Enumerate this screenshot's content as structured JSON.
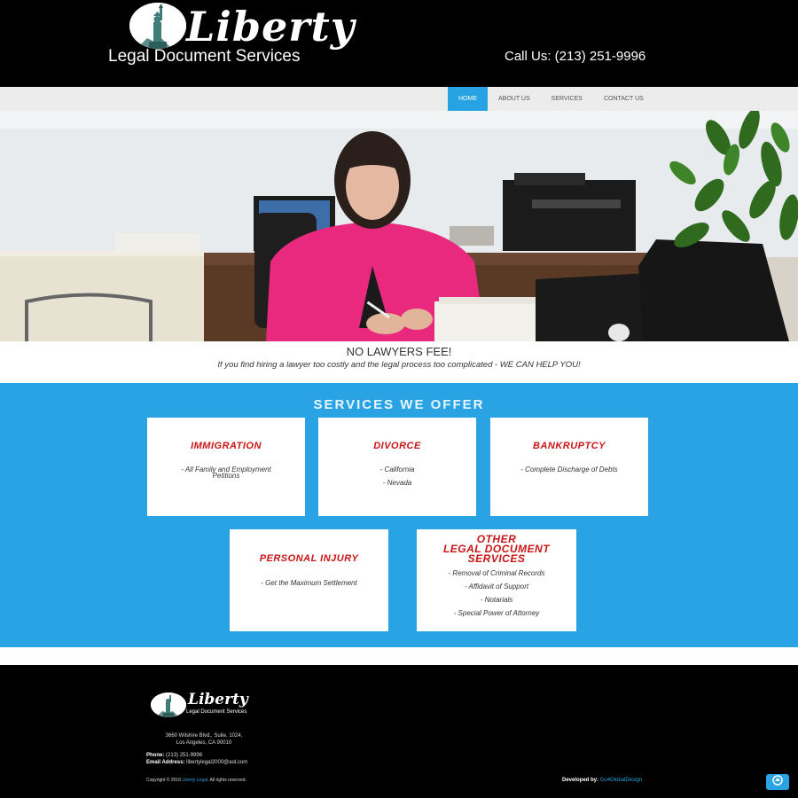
{
  "header": {
    "logo_word": "Liberty",
    "logo_subtitle": "Legal Document Services",
    "phone": "Call Us: (213) 251-9996",
    "logo_icon": "statue-of-liberty-icon"
  },
  "nav": {
    "items": [
      {
        "label": "HOME",
        "active": true
      },
      {
        "label": "ABOUT US",
        "active": false
      },
      {
        "label": "SERVICES",
        "active": false
      },
      {
        "label": "CONTACT US",
        "active": false
      }
    ]
  },
  "hero": {
    "image": "woman-at-office-desk-photo"
  },
  "tagline": {
    "title": "NO LAWYERS FEE!",
    "subtitle": "If you find hiring a lawyer too costly and the legal process too complicated -  WE CAN HELP YOU!"
  },
  "services": {
    "title": "SERVICES  WE  OFFER",
    "cards": [
      {
        "title": "IMMIGRATION",
        "items": [
          "- All Family and Employment",
          "Petitions"
        ]
      },
      {
        "title": "DIVORCE",
        "items": [
          "- California",
          "- Nevada"
        ]
      },
      {
        "title": "BANKRUPTCY",
        "items": [
          "- Complete Discharge of Debts"
        ]
      },
      {
        "title": "PERSONAL INJURY",
        "items": [
          "- Get the Maximum Settlement"
        ]
      },
      {
        "title_lines": [
          "OTHER",
          "LEGAL DOCUMENT",
          "SERVICES"
        ],
        "items": [
          "- Removal of Criminal Records",
          "- Affidavit of Support",
          "- Notarials",
          "- Special Power of Attorney"
        ]
      }
    ]
  },
  "footer": {
    "logo_word": "Liberty",
    "logo_subtitle": "Legal Document Services",
    "address_line1": "3660 Wilshire Blvd., Suite, 1024,",
    "address_line2": "Los Angeles, CA 90010",
    "phone_label": "Phone:",
    "phone_value": "(213) 251-9996",
    "email_label": "Email Address:",
    "email_value": "libertylegal2000@aol.com",
    "copyright_prefix": "Copyright © 2016",
    "copyright_link": "Liberty Legal",
    "copyright_suffix": ". All rights reserved.",
    "developed_label": "Developed by:",
    "developed_link": "Go4GlobalDesign",
    "scroll_top_icon": "arrow-up-icon"
  },
  "colors": {
    "accent": "#2aa3e4",
    "title_red": "#c91515",
    "header_bg": "#000000"
  }
}
